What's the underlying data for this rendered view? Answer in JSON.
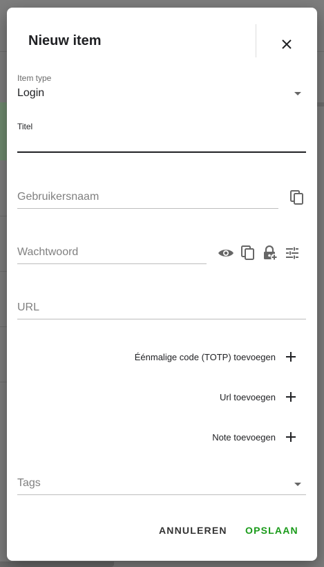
{
  "dialog": {
    "title": "Nieuw item",
    "item_type": {
      "label": "Item type",
      "value": "Login"
    },
    "titel": {
      "label": "Titel",
      "value": ""
    },
    "username": {
      "placeholder": "Gebruikersnaam"
    },
    "password": {
      "placeholder": "Wachtwoord"
    },
    "url": {
      "placeholder": "URL"
    },
    "add_actions": [
      {
        "label": "Éénmalige code (TOTP) toevoegen"
      },
      {
        "label": "Url toevoegen"
      },
      {
        "label": "Note toevoegen"
      }
    ],
    "tags": {
      "placeholder": "Tags"
    },
    "cancel_label": "ANNULEREN",
    "save_label": "OPSLAAN"
  },
  "colors": {
    "accent": "#1a9b1a",
    "text": "#202124",
    "hint": "#808080"
  },
  "icons": [
    "close-icon",
    "dropdown-caret-icon",
    "copy-icon",
    "eye-icon",
    "lock-add-icon",
    "tune-icon",
    "plus-icon"
  ]
}
